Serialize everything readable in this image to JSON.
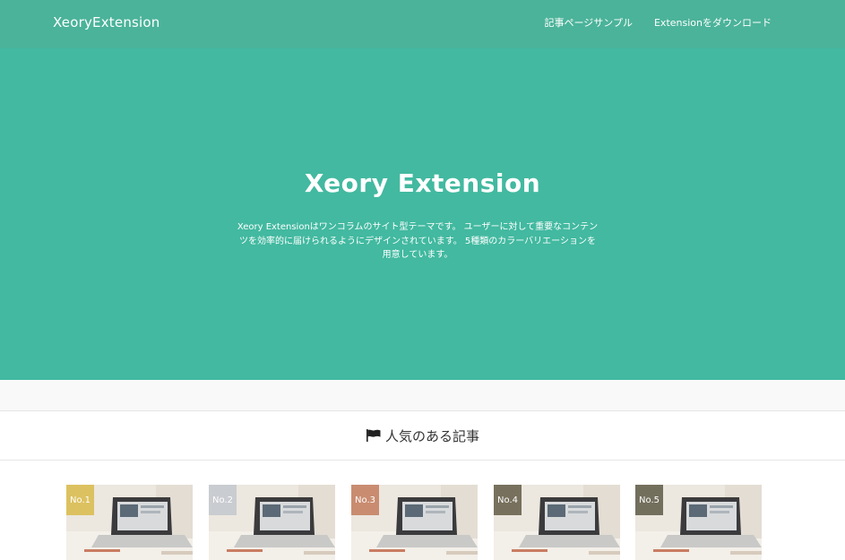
{
  "header": {
    "site_title": "XeoryExtension",
    "nav": [
      "記事ページサンプル",
      "Extensionをダウンロード"
    ]
  },
  "hero": {
    "title": "Xeory Extension",
    "lines": [
      "Xeory Extensionはワンコラムのサイト型テーマです。 ユーザーに対して重要なコンテン",
      "ツを効率的に届けられるようにデザインされています。 5種類のカラーバリエーションを",
      "用意しています。"
    ]
  },
  "popular": {
    "icon": "flag-icon",
    "title": "人気のある記事",
    "items": [
      {
        "rank": "No.1",
        "badge_color": "#dcc160"
      },
      {
        "rank": "No.2",
        "badge_color": "#c9ccd0"
      },
      {
        "rank": "No.3",
        "badge_color": "#c98c70"
      },
      {
        "rank": "No.4",
        "badge_color": "#77705c"
      },
      {
        "rank": "No.5",
        "badge_color": "#736f5d"
      }
    ]
  },
  "colors": {
    "header": "#4bb39a",
    "hero": "#42b9a0"
  }
}
